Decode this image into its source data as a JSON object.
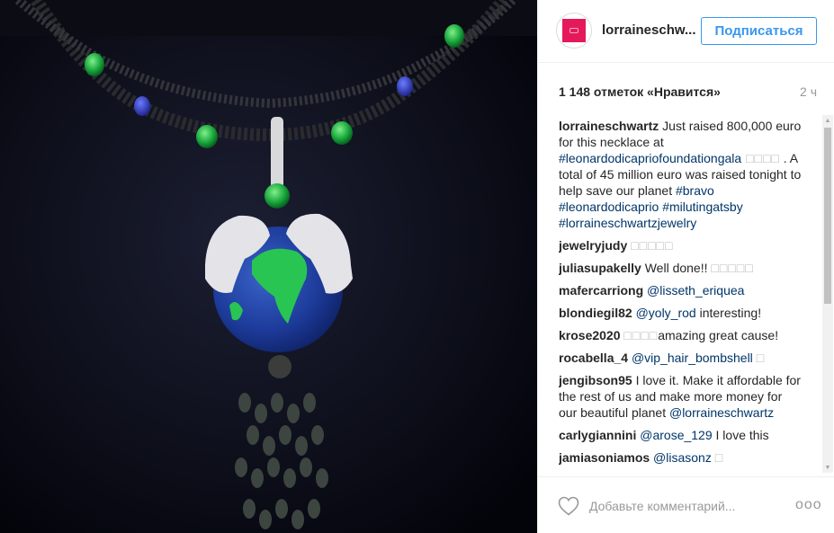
{
  "post": {
    "username": "lorraineschwartz",
    "username_display": "lorraineschwartz",
    "follow_label": "Подписаться",
    "likes": "1 148 отметок «Нравится»",
    "time": "2 ч"
  },
  "caption": {
    "user": "lorraineschwartz",
    "text_1": "Just raised 800,000 euro for this necklace at ",
    "tag_1": "#leonardodicapriofoundationgala",
    "emoji_1": " □□□□",
    "text_2": " . A total of 45 million euro was raised tonight to help save our planet ",
    "tag_2": "#bravo",
    "tag_3": "#leonardodicaprio",
    "tag_4": "#milutingatsby",
    "tag_5": "#lorraineschwartzjewelry"
  },
  "comments": [
    {
      "user": "jewelryjudy",
      "text": "",
      "mention": "",
      "emoji": "□□□□□"
    },
    {
      "user": "juliasupakelly",
      "text": "Well done!! ",
      "mention": "",
      "emoji": "□□□□□"
    },
    {
      "user": "mafercarriong",
      "text": "",
      "mention": "@lisseth_eriquea",
      "emoji": ""
    },
    {
      "user": "blondiegil82",
      "text_after": " interesting!",
      "mention": "@yoly_rod",
      "emoji": ""
    },
    {
      "user": "krose2020",
      "text": "amazing great cause!",
      "mention": "",
      "emoji": "□□□□"
    },
    {
      "user": "rocabella_4",
      "text": "",
      "mention": "@vip_hair_bombshell",
      "emoji": "□"
    },
    {
      "user": "jengibson95",
      "text": "I love it. Make it affordable for the rest of us and make more money for our beautiful planet ",
      "mention": "@lorraineschwartz",
      "emoji": ""
    },
    {
      "user": "carlygiannini",
      "text_after": " I love this",
      "mention": "@arose_129",
      "emoji": ""
    },
    {
      "user": "jamiasoniamos",
      "text": "",
      "mention": "@lisasonz",
      "emoji": "□"
    }
  ],
  "footer": {
    "comment_placeholder": "Добавьте комментарий...",
    "more_label": "ooo"
  },
  "icons": {
    "avatar": "avatar-icon",
    "heart": "heart-icon",
    "more": "more-options-icon"
  },
  "colors": {
    "link": "#003569",
    "follow": "#3897f0",
    "avatar_bg": "#e5195a"
  }
}
